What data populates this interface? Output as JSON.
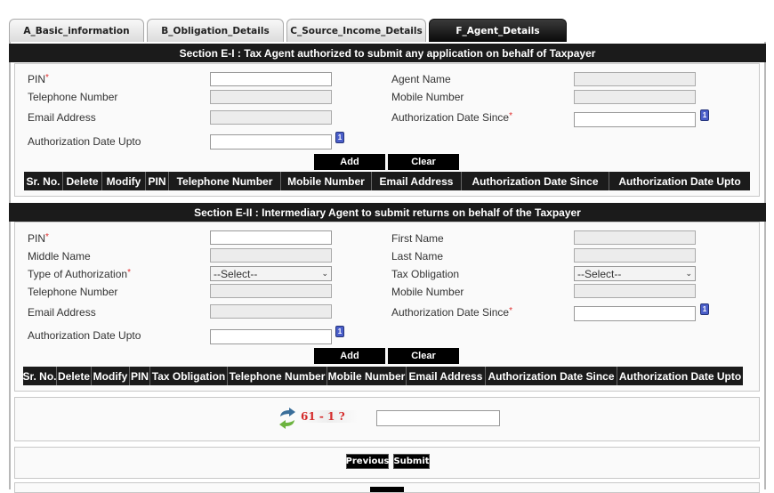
{
  "tabs": [
    {
      "label": "A_Basic_information",
      "active": false
    },
    {
      "label": "B_Obligation_Details",
      "active": false
    },
    {
      "label": "C_Source_Income_Details",
      "active": false
    },
    {
      "label": "F_Agent_Details",
      "active": true
    }
  ],
  "section1": {
    "title": "Section E-I : Tax Agent authorized to submit any application on behalf of Taxpayer",
    "fields": {
      "pin": {
        "label": "PIN",
        "required": "*",
        "value": ""
      },
      "agent_name": {
        "label": "Agent Name",
        "value": ""
      },
      "telephone": {
        "label": "Telephone Number",
        "value": ""
      },
      "mobile": {
        "label": "Mobile Number",
        "value": ""
      },
      "email": {
        "label": "Email Address",
        "value": ""
      },
      "date_since": {
        "label": "Authorization Date Since",
        "required": "*",
        "value": ""
      },
      "date_upto": {
        "label": "Authorization Date Upto",
        "value": ""
      }
    },
    "add_label": "Add",
    "clear_label": "Clear",
    "columns": [
      "Sr. No.",
      "Delete",
      "Modify",
      "PIN",
      "Telephone Number",
      "Mobile Number",
      "Email Address",
      "Authorization Date Since",
      "Authorization Date Upto"
    ]
  },
  "section2": {
    "title": "Section E-II : Intermediary Agent to submit returns on behalf of the Taxpayer",
    "fields": {
      "pin": {
        "label": "PIN",
        "required": "*",
        "value": ""
      },
      "first_name": {
        "label": "First Name",
        "value": ""
      },
      "middle_name": {
        "label": "Middle Name",
        "value": ""
      },
      "last_name": {
        "label": "Last Name",
        "value": ""
      },
      "auth_type": {
        "label": "Type of Authorization",
        "required": "*",
        "selected": "--Select--"
      },
      "tax_obligation": {
        "label": "Tax Obligation",
        "selected": "--Select--"
      },
      "telephone": {
        "label": "Telephone Number",
        "value": ""
      },
      "mobile": {
        "label": "Mobile Number",
        "value": ""
      },
      "email": {
        "label": "Email Address",
        "value": ""
      },
      "date_since": {
        "label": "Authorization Date Since",
        "required": "*",
        "value": ""
      },
      "date_upto": {
        "label": "Authorization Date Upto",
        "value": ""
      }
    },
    "add_label": "Add",
    "clear_label": "Clear",
    "columns": [
      "Sr. No.",
      "Delete",
      "Modify",
      "PIN",
      "Tax Obligation",
      "Telephone Number",
      "Mobile Number",
      "Email Address",
      "Authorization Date Since",
      "Authorization Date Upto"
    ]
  },
  "captcha": {
    "question": "61 - 1 ?",
    "answer": "",
    "refresh_icon": "refresh-arrows-icon",
    "question_color": "#d42a2a"
  },
  "nav": {
    "previous_label": "Previous",
    "submit_label": "Submit"
  },
  "icons": {
    "calendar": "calendar-icon",
    "calendar_glyph": "1",
    "chevron": "⌄"
  }
}
